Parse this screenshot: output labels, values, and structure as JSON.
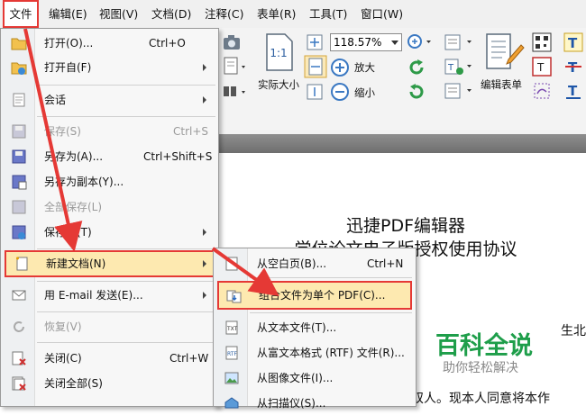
{
  "menubar": {
    "items": [
      "文件",
      "编辑(E)",
      "视图(V)",
      "文档(D)",
      "注释(C)",
      "表单(R)",
      "工具(T)",
      "窗口(W)"
    ]
  },
  "toolbar": {
    "zoom": "118.57%",
    "actual_size": "实际大小",
    "actual_size_glyph": "1:1",
    "zoom_in": "放大",
    "zoom_out": "缩小",
    "edit_form": "编辑表单"
  },
  "file_menu": {
    "items": [
      {
        "label": "打开(O)...",
        "shortcut": "Ctrl+O",
        "icon": "folder-open-icon",
        "submenu": false,
        "disabled": false
      },
      {
        "label": "打开自(F)",
        "shortcut": "",
        "icon": "folder-globe-icon",
        "submenu": true,
        "disabled": false
      },
      {
        "label": "会话",
        "shortcut": "",
        "icon": "session-icon",
        "submenu": true,
        "disabled": false
      },
      {
        "label": "保存(S)",
        "shortcut": "Ctrl+S",
        "icon": "save-icon",
        "submenu": false,
        "disabled": true
      },
      {
        "label": "另存为(A)...",
        "shortcut": "Ctrl+Shift+S",
        "icon": "save-as-icon",
        "submenu": false,
        "disabled": false
      },
      {
        "label": "另存为副本(Y)...",
        "shortcut": "",
        "icon": "save-copy-icon",
        "submenu": false,
        "disabled": false
      },
      {
        "label": "全部保存(L)",
        "shortcut": "",
        "icon": "save-all-icon",
        "submenu": false,
        "disabled": true
      },
      {
        "label": "保存到(T)",
        "shortcut": "",
        "icon": "save-to-icon",
        "submenu": true,
        "disabled": false
      },
      {
        "label": "新建文档(N)",
        "shortcut": "",
        "icon": "new-document-icon",
        "submenu": true,
        "disabled": false
      },
      {
        "label": "用 E-mail 发送(E)...",
        "shortcut": "",
        "icon": "email-icon",
        "submenu": true,
        "disabled": false
      },
      {
        "label": "恢复(V)",
        "shortcut": "",
        "icon": "revert-icon",
        "submenu": false,
        "disabled": true
      },
      {
        "label": "关闭(C)",
        "shortcut": "Ctrl+W",
        "icon": "close-doc-icon",
        "submenu": false,
        "disabled": false
      },
      {
        "label": "关闭全部(S)",
        "shortcut": "",
        "icon": "close-all-icon",
        "submenu": false,
        "disabled": false
      }
    ]
  },
  "new_doc_submenu": {
    "items": [
      {
        "label": "从空白页(B)...",
        "shortcut": "Ctrl+N",
        "icon": "blank-page-icon"
      },
      {
        "label": "组合文件为单个 PDF(C)...",
        "shortcut": "",
        "icon": "combine-files-icon"
      },
      {
        "label": "从文本文件(T)...",
        "shortcut": "",
        "icon": "text-file-icon"
      },
      {
        "label": "从富文本格式 (RTF) 文件(R)...",
        "shortcut": "",
        "icon": "rtf-file-icon"
      },
      {
        "label": "从图像文件(I)...",
        "shortcut": "",
        "icon": "image-file-icon"
      },
      {
        "label": "从扫描仪(S)...",
        "shortcut": "",
        "icon": "scanner-icon"
      }
    ]
  },
  "document": {
    "title1": "迅捷PDF编辑器",
    "title2": "学位论文电子版授权使用协议",
    "fragment1": "生北",
    "fragment2": "双人。现本人同意将本作"
  },
  "watermark": {
    "main": "百科全说",
    "sub": "助你轻松解决"
  },
  "colors": {
    "highlight_border": "#e53935",
    "highlight_fill": "#fde9b0",
    "watermark_green": "#1e9e4a"
  }
}
